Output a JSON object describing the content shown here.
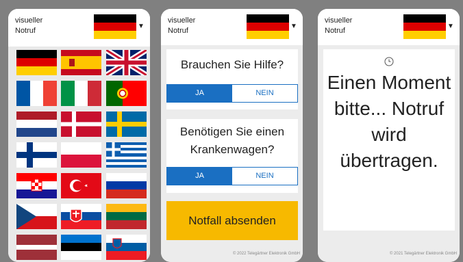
{
  "header": {
    "title_line1": "visueller",
    "title_line2": "Notruf",
    "selected_language": "German"
  },
  "languages": [
    "German",
    "Spanish",
    "English (UK)",
    "French",
    "Italian",
    "Portuguese",
    "Dutch",
    "Danish",
    "Swedish",
    "Finnish",
    "Polish",
    "Greek",
    "Croatian",
    "Turkish",
    "Russian",
    "Czech",
    "Slovak",
    "Lithuanian",
    "Latvian",
    "Estonian",
    "Slovenian"
  ],
  "questions": [
    {
      "text": "Brauchen Sie Hilfe?",
      "yes": "JA",
      "no": "NEIN",
      "selected": "yes"
    },
    {
      "text": "Benötigen Sie einen Krankenwagen?",
      "yes": "JA",
      "no": "NEIN",
      "selected": "yes"
    }
  ],
  "send_button": "Notfall absenden",
  "copyright_2": "© 2022 Telegärtner Elektronik GmbH",
  "copyright_3": "© 2021 Telegärtner Elektronik GmbH",
  "status_message": "Einen Moment bitte... Notruf wird übertragen.",
  "icons": {
    "clock": "clock-icon",
    "dropdown": "chevron-down-icon"
  },
  "colors": {
    "accent": "#1a6fc2",
    "send": "#f7b900",
    "frame": "#808080"
  }
}
